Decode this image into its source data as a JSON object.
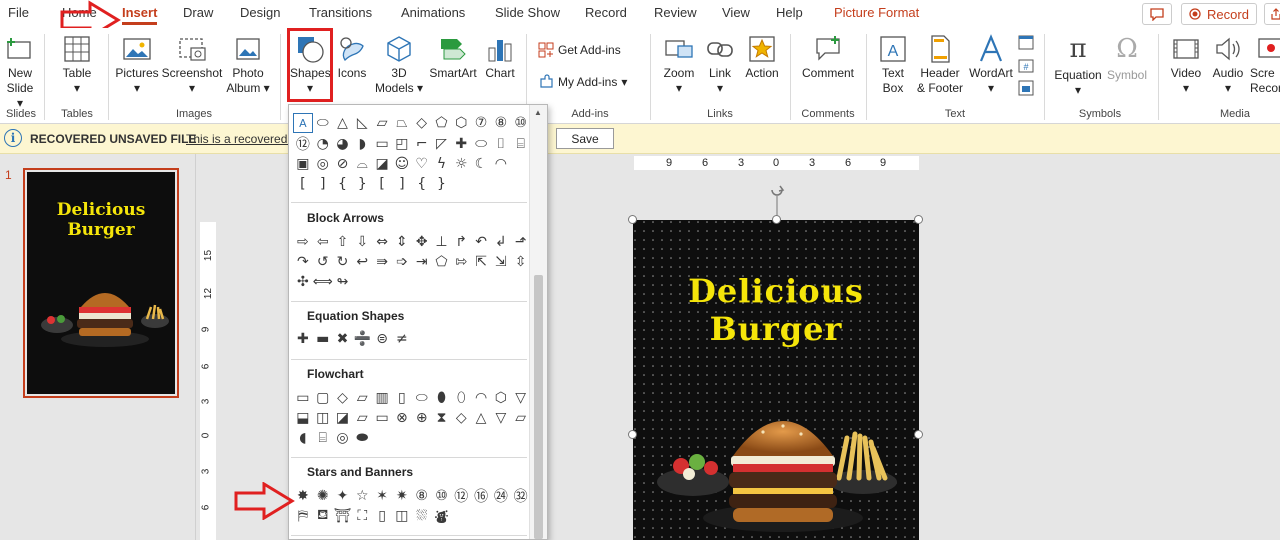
{
  "tabs": [
    {
      "label": "File"
    },
    {
      "label": "Home"
    },
    {
      "label": "Insert"
    },
    {
      "label": "Draw"
    },
    {
      "label": "Design"
    },
    {
      "label": "Transitions"
    },
    {
      "label": "Animations"
    },
    {
      "label": "Slide Show"
    },
    {
      "label": "Record"
    },
    {
      "label": "Review"
    },
    {
      "label": "View"
    },
    {
      "label": "Help"
    },
    {
      "label": "Picture Format"
    }
  ],
  "record_button": "Record",
  "ribbon": {
    "new_slide": {
      "line1": "New",
      "line2": "Slide"
    },
    "table": "Table",
    "pictures": "Pictures",
    "screenshot": "Screenshot",
    "photo_album": {
      "line1": "Photo",
      "line2": "Album"
    },
    "shapes": "Shapes",
    "icons": "Icons",
    "models": {
      "line1": "3D",
      "line2": "Models"
    },
    "smartart": "SmartArt",
    "chart": "Chart",
    "get_addins": "Get Add-ins",
    "my_addins": "My Add-ins",
    "zoom": "Zoom",
    "link": "Link",
    "action": "Action",
    "comment": "Comment",
    "text_box": {
      "line1": "Text",
      "line2": "Box"
    },
    "header_footer": {
      "line1": "Header",
      "line2": "& Footer"
    },
    "wordart": "WordArt",
    "equation": "Equation",
    "symbol": "Symbol",
    "video": "Video",
    "audio": "Audio",
    "screen_rec": {
      "line1": "Scre",
      "line2": "Recor"
    },
    "groups": {
      "slides": "Slides",
      "tables": "Tables",
      "images": "Images",
      "addins": "Add-ins",
      "links": "Links",
      "comments": "Comments",
      "text": "Text",
      "symbols": "Symbols",
      "media": "Media"
    }
  },
  "infobar": {
    "title": "RECOVERED UNSAVED FILE",
    "message": "This is a recovered fi",
    "save_button": "Save"
  },
  "slide_number": "1",
  "slide_title_line1": "Delicious",
  "slide_title_line2": "Burger",
  "ruler_h": [
    "9",
    "6",
    "3",
    "0",
    "3",
    "6",
    "9"
  ],
  "ruler_v": [
    "15",
    "12",
    "9",
    "6",
    "3",
    "0",
    "3",
    "6"
  ],
  "shapes_panel": {
    "sections": {
      "block_arrows": "Block Arrows",
      "equation_shapes": "Equation Shapes",
      "flowchart": "Flowchart",
      "stars_banners": "Stars and Banners"
    },
    "rows": {
      "basic1": [
        "A",
        "⬭",
        "△",
        "◺",
        "▱",
        "⏢",
        "◇",
        "⬠",
        "⬡",
        "⑦",
        "⑧",
        "⑩"
      ],
      "basic2": [
        "⑫",
        "◔",
        "◕",
        "◗",
        "▭",
        "◰",
        "⌐",
        "◸",
        "✚",
        "⬭",
        "⌷",
        "⌸"
      ],
      "basic3": [
        "▣",
        "◎",
        "⊘",
        "⌓",
        "◪",
        "☺",
        "♡",
        "ϟ",
        "☼",
        "☾",
        "◠",
        ""
      ],
      "basic4": [
        "[",
        "]",
        "{",
        "}",
        "[",
        "]",
        "{",
        "}",
        "",
        "",
        "",
        ""
      ],
      "arrows1": [
        "⇨",
        "⇦",
        "⇧",
        "⇩",
        "⇔",
        "⇕",
        "✥",
        "⊥",
        "↱",
        "↶",
        "↲",
        "⬏"
      ],
      "arrows2": [
        "↷",
        "↺",
        "↻",
        "↩",
        "⇛",
        "➩",
        "⇥",
        "⬠",
        "⇰",
        "⇱",
        "⇲",
        "⇳"
      ],
      "arrows3": [
        "✣",
        "⟺",
        "↬",
        "",
        "",
        "",
        "",
        "",
        "",
        "",
        "",
        ""
      ],
      "equation": [
        "✚",
        "▬",
        "✖",
        "➗",
        "⊜",
        "≠",
        "",
        "",
        "",
        "",
        "",
        ""
      ],
      "flow1": [
        "▭",
        "▢",
        "◇",
        "▱",
        "▥",
        "▯",
        "⬭",
        "⬮",
        "⬯",
        "◠",
        "⬡",
        "▽"
      ],
      "flow2": [
        "⬓",
        "◫",
        "◪",
        "⏥",
        "▭",
        "⊗",
        "⊕",
        "⧗",
        "◇",
        "△",
        "▽",
        "▱"
      ],
      "flow3": [
        "◖",
        "⌸",
        "◎",
        "⬬",
        "",
        "",
        "",
        "",
        "",
        "",
        "",
        ""
      ],
      "stars1": [
        "✸",
        "✺",
        "✦",
        "☆",
        "✶",
        "✷",
        "⑧",
        "⑩",
        "⑫",
        "⑯",
        "㉔",
        "㉜"
      ],
      "stars2": [
        "⛿",
        "⛾",
        "⛩",
        "⛶",
        "▯",
        "◫",
        "⛆",
        "⛇",
        "",
        "",
        "",
        ""
      ]
    }
  },
  "colors": {
    "accent": "#c43e1c",
    "highlight_red": "#e02020",
    "title_yellow": "#f5e50a",
    "infobar_bg": "#fdf6d1"
  }
}
